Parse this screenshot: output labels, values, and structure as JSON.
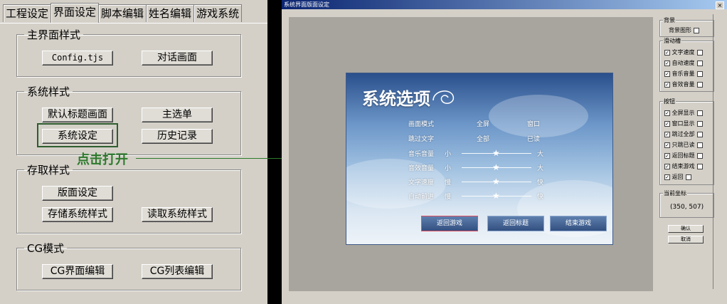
{
  "left": {
    "tabs": [
      "工程设定",
      "界面设定",
      "脚本编辑",
      "姓名编辑",
      "游戏系统"
    ],
    "active_tab": 1,
    "groups": {
      "main": {
        "title": "主界面样式",
        "buttons": [
          "Config.tjs",
          "对话画面"
        ]
      },
      "system": {
        "title": "系统样式",
        "buttons": [
          "默认标题画面",
          "主选单",
          "系统设定",
          "历史记录"
        ]
      },
      "save": {
        "title": "存取样式",
        "buttons": [
          "版面设定",
          "存储系统样式",
          "读取系统样式"
        ]
      },
      "cg": {
        "title": "CG模式",
        "buttons": [
          "CG界面编辑",
          "CG列表编辑"
        ]
      }
    },
    "annotation": "点击打开",
    "annotation_color": "#2c7a2c"
  },
  "window": {
    "title": "系统界面版面设定",
    "close": "×",
    "preview": {
      "title": "系统选项",
      "rows": [
        {
          "label": "画面模式",
          "opt1": "全屏",
          "opt2": "窗口"
        },
        {
          "label": "跳过文字",
          "opt1": "全部",
          "opt2": "已读"
        }
      ],
      "sliders": [
        {
          "label": "音乐音量",
          "min": "小",
          "max": "大",
          "level": 0.5
        },
        {
          "label": "音效音量",
          "min": "小",
          "max": "大",
          "level": 0.5
        },
        {
          "label": "文字速度",
          "min": "慢",
          "max": "快",
          "level": 0.5
        },
        {
          "label": "自动前进",
          "min": "慢",
          "max": "快",
          "level": 0.5
        }
      ],
      "knob_glyph": "★",
      "buttons": [
        "返回游戏",
        "返回标题",
        "结束游戏"
      ],
      "selected_button": 0
    },
    "sidebar": {
      "bg_group": "背景",
      "bg_item": "背景图形",
      "slider_group": "滑动槽",
      "slider_items": [
        "文字速度",
        "自动速度",
        "音乐音量",
        "音效音量"
      ],
      "button_group": "按钮",
      "button_items": [
        "全屏显示",
        "窗口显示",
        "跳过全部",
        "只跳已读",
        "返回标题",
        "结束游戏",
        "返回"
      ],
      "coord_group": "当前坐标",
      "coord_value": "(350, 507)",
      "check_glyph": "✓",
      "ok": "确认",
      "cancel": "取消"
    }
  }
}
